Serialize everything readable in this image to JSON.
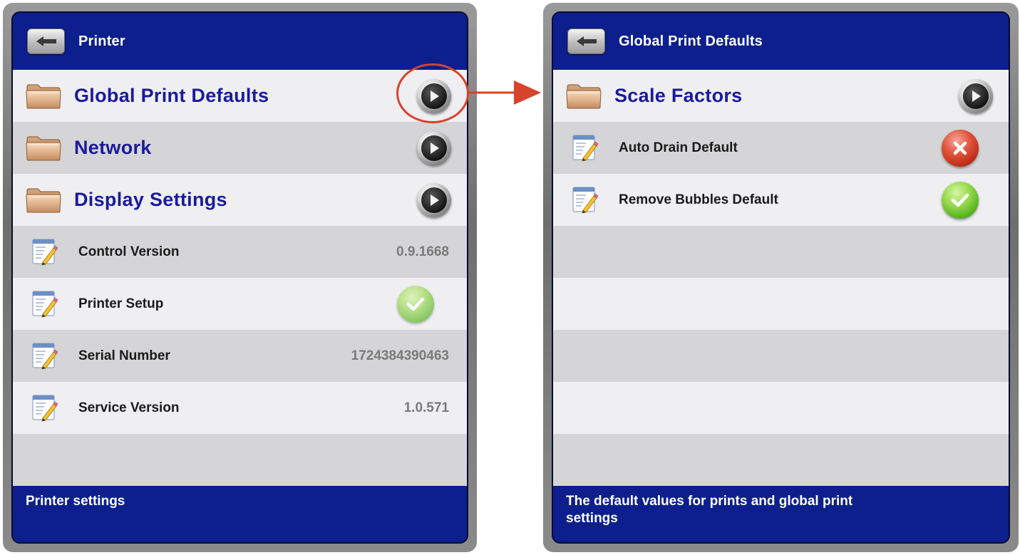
{
  "left_screen": {
    "header": {
      "title": "Printer",
      "back_icon": "back-arrow-icon"
    },
    "folders": [
      {
        "label": "Global Print Defaults",
        "icon": "folder-icon",
        "action_icon": "play-arrow-icon"
      },
      {
        "label": "Network",
        "icon": "folder-icon",
        "action_icon": "play-arrow-icon"
      },
      {
        "label": "Display Settings",
        "icon": "folder-icon",
        "action_icon": "play-arrow-icon"
      }
    ],
    "items": [
      {
        "label": "Control Version",
        "value": "0.9.1668",
        "icon": "document-edit-icon"
      },
      {
        "label": "Printer Setup",
        "status": "checked",
        "icon": "document-edit-icon"
      },
      {
        "label": "Serial Number",
        "value": "1724384390463",
        "icon": "document-edit-icon"
      },
      {
        "label": "Service Version",
        "value": "1.0.571",
        "icon": "document-edit-icon"
      }
    ],
    "footer": {
      "text": "Printer settings"
    }
  },
  "right_screen": {
    "header": {
      "title": "Global Print Defaults",
      "back_icon": "back-arrow-icon"
    },
    "folders": [
      {
        "label": "Scale Factors",
        "icon": "folder-icon",
        "action_icon": "play-arrow-icon"
      }
    ],
    "items": [
      {
        "label": "Auto Drain Default",
        "status": "off",
        "icon": "document-edit-icon"
      },
      {
        "label": "Remove Bubbles Default",
        "status": "on",
        "icon": "document-edit-icon"
      }
    ],
    "footer": {
      "text": "The default values for prints and global print settings"
    }
  },
  "annotation": {
    "highlight_color": "#d7432d",
    "arrow_color": "#d7432d"
  },
  "colors": {
    "header_blue": "#0c1f8c",
    "folder_label": "#1a1a9e",
    "row_light": "#efeef1",
    "row_dark": "#d5d5d7",
    "check_green": "#4fb21a",
    "x_red": "#b8250f"
  }
}
